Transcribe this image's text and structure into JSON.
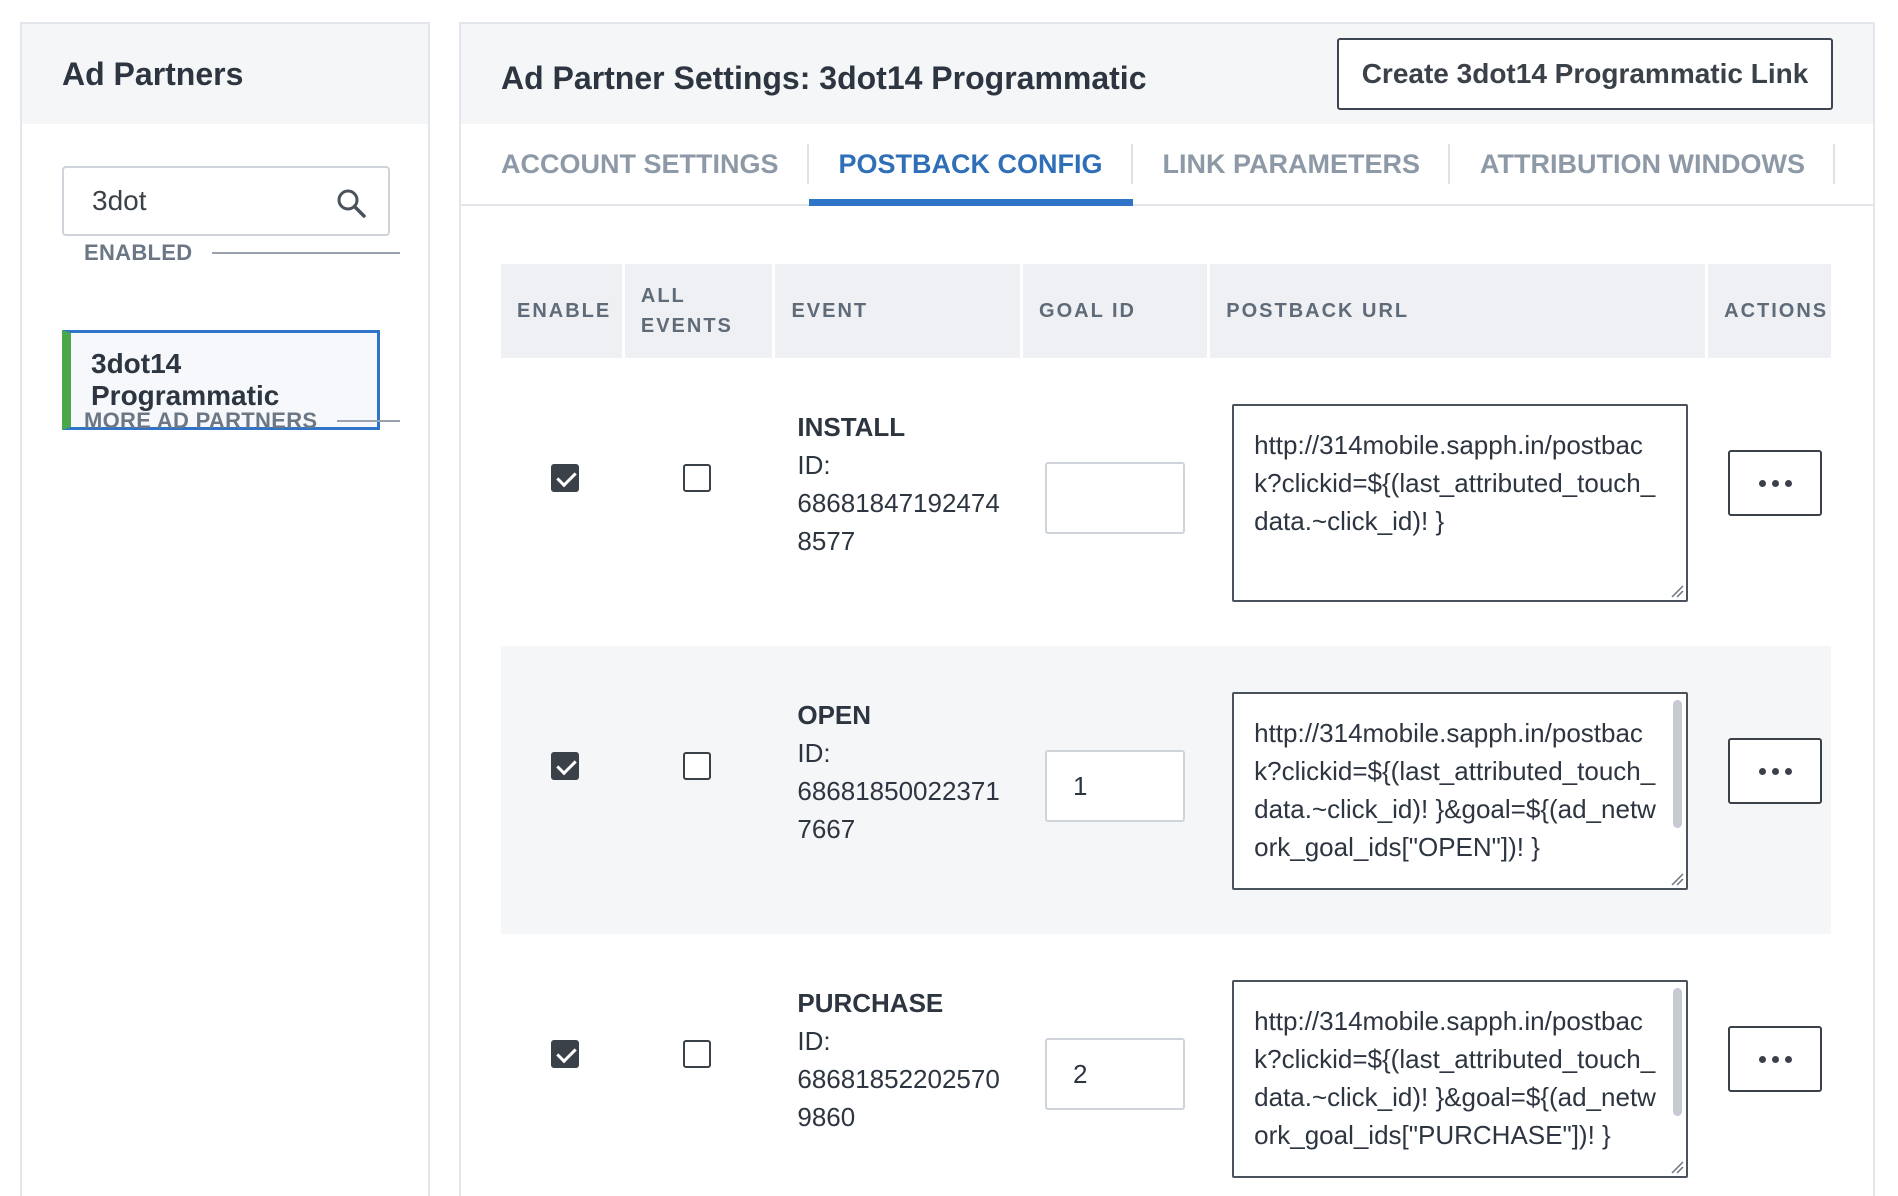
{
  "sidebar": {
    "title": "Ad Partners",
    "search": {
      "value": "3dot",
      "placeholder": ""
    },
    "enabled_label": "ENABLED",
    "enabled_items": [
      {
        "label": "3dot14 Programmatic",
        "selected": true,
        "status_color": "#4aa84a"
      }
    ],
    "more_label": "MORE AD PARTNERS"
  },
  "main": {
    "title": "Ad Partner Settings: 3dot14 Programmatic",
    "create_button": "Create 3dot14 Programmatic Link",
    "tabs": [
      {
        "label": "ACCOUNT SETTINGS",
        "active": false
      },
      {
        "label": "POSTBACK CONFIG",
        "active": true
      },
      {
        "label": "LINK PARAMETERS",
        "active": false
      },
      {
        "label": "ATTRIBUTION WINDOWS",
        "active": false
      }
    ],
    "table": {
      "headers": {
        "enable": "ENABLE",
        "all_events_1": "ALL",
        "all_events_2": "EVENTS",
        "event": "EVENT",
        "goal_id": "GOAL ID",
        "postback_url": "POSTBACK URL",
        "actions": "ACTIONS"
      },
      "rows": [
        {
          "enable": true,
          "all_events": false,
          "event": "INSTALL",
          "id_label": "ID:",
          "id": "686818471924748577",
          "goal_id": "",
          "postback_url": "http://314mobile.sapph.in/postback?clickid=${(last_attributed_touch_data.~click_id)! }"
        },
        {
          "enable": true,
          "all_events": false,
          "event": "OPEN",
          "id_label": "ID:",
          "id": "686818500223717667",
          "goal_id": "1",
          "postback_url": "http://314mobile.sapph.in/postback?clickid=${(last_attributed_touch_data.~click_id)! }&goal=${(ad_network_goal_ids[\"OPEN\"])! }"
        },
        {
          "enable": true,
          "all_events": false,
          "event": "PURCHASE",
          "id_label": "ID:",
          "id": "686818522025709860",
          "goal_id": "2",
          "postback_url": "http://314mobile.sapph.in/postback?clickid=${(last_attributed_touch_data.~click_id)! }&goal=${(ad_network_goal_ids[\"PURCHASE\"])! }"
        }
      ]
    }
  },
  "colors": {
    "accent": "#2f74c7",
    "enabled_bar": "#4aa84a",
    "header_bg": "#f5f6f8"
  },
  "icons": {
    "search": "search-icon",
    "actions": "ellipsis-icon",
    "resize": "resize-handle-icon"
  }
}
